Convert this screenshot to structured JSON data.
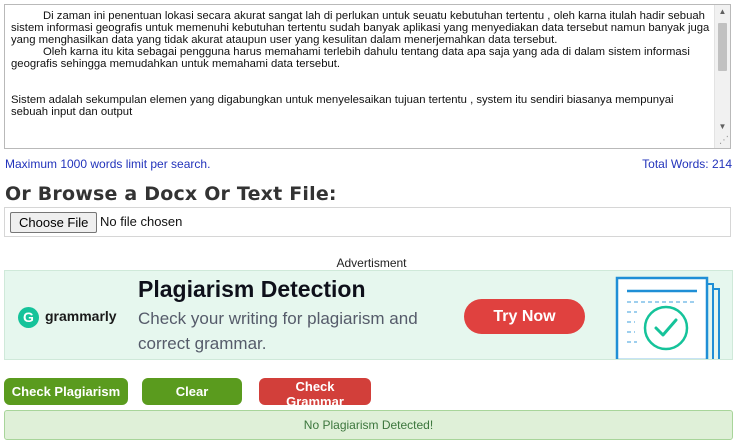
{
  "editor": {
    "paragraph_1": "Di zaman ini penentuan lokasi secara akurat sangat lah di perlukan untuk seuatu kebutuhan tertentu , oleh karna itulah hadir sebuah sistem informasi geografis untuk memenuhi kebutuhan tertentu sudah banyak aplikasi yang menyediakan data tersebut namun banyak juga yang menghasilkan data yang tidak akurat ataupun user yang kesulitan dalam menerjemahkan data tersebut.",
    "paragraph_2": "Oleh karna itu kita sebagai pengguna harus memahami terlebih dahulu tentang data apa saja yang ada di dalam sistem informasi geografis sehingga memudahkan untuk memahami data tersebut.",
    "paragraph_3": "Sistem adalah sekumpulan elemen yang digabungkan untuk menyelesaikan tujuan tertentu , system itu sendiri biasanya mempunyai sebuah input dan output"
  },
  "limit_note": "Maximum 1000 words limit per search.",
  "total_words": "Total Words: 214",
  "browse_heading": "Or Browse a Docx Or Text File:",
  "file_input": {
    "button_label": "Choose File",
    "status": "No file chosen"
  },
  "ad": {
    "label": "Advertisment",
    "brand": "grammarly",
    "logo_letter": "G",
    "title": "Plagiarism Detection",
    "subtitle": "Check your writing for plagiarism and correct grammar.",
    "cta": "Try Now"
  },
  "actions": {
    "check_plagiarism": "Check Plagiarism",
    "clear": "Clear",
    "check_grammar": "Check Grammar"
  },
  "result": "No Plagiarism Detected!",
  "colors": {
    "green_button": "#5a9b1e",
    "red_button": "#d23f3a",
    "link_blue": "#2233bb",
    "ad_background": "#e6f7ee",
    "result_background": "#dff0d8"
  }
}
